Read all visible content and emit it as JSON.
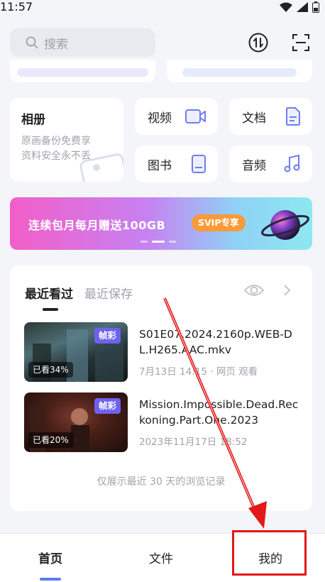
{
  "status_bar": {
    "time": "11:57"
  },
  "search": {
    "placeholder": "搜索"
  },
  "album": {
    "title": "相册",
    "line1": "原画备份免费享",
    "line2": "资料安全永不丢"
  },
  "tiles": [
    {
      "label": "视频",
      "icon": "video-icon"
    },
    {
      "label": "文档",
      "icon": "document-icon"
    },
    {
      "label": "图书",
      "icon": "book-icon"
    },
    {
      "label": "音频",
      "icon": "music-icon"
    }
  ],
  "banner": {
    "text": "连续包月每月赠送100GB",
    "tag": "SVIP专享"
  },
  "recent": {
    "tabs": [
      "最近看过",
      "最近保存"
    ],
    "items": [
      {
        "name": "S01E07.2024.2160p.WEB-DL.H265.AAC.mkv",
        "meta": "7月13日 14:15 · 网页 观看",
        "badge": "帧彩",
        "progress": "已看34%"
      },
      {
        "name": "Mission.Impossible.Dead.Reckoning.Part.One.2023",
        "meta": "2023年11月17日 18:52",
        "badge": "帧彩",
        "progress": "已看20%"
      }
    ],
    "note": "仅展示最近 30 天的浏览记录"
  },
  "bottom_nav": {
    "home": "首页",
    "files": "文件",
    "mine": "我的"
  },
  "colors": {
    "accent": "#5a7cf2",
    "badge": "#6d62ee",
    "annotation": "#e31818"
  }
}
